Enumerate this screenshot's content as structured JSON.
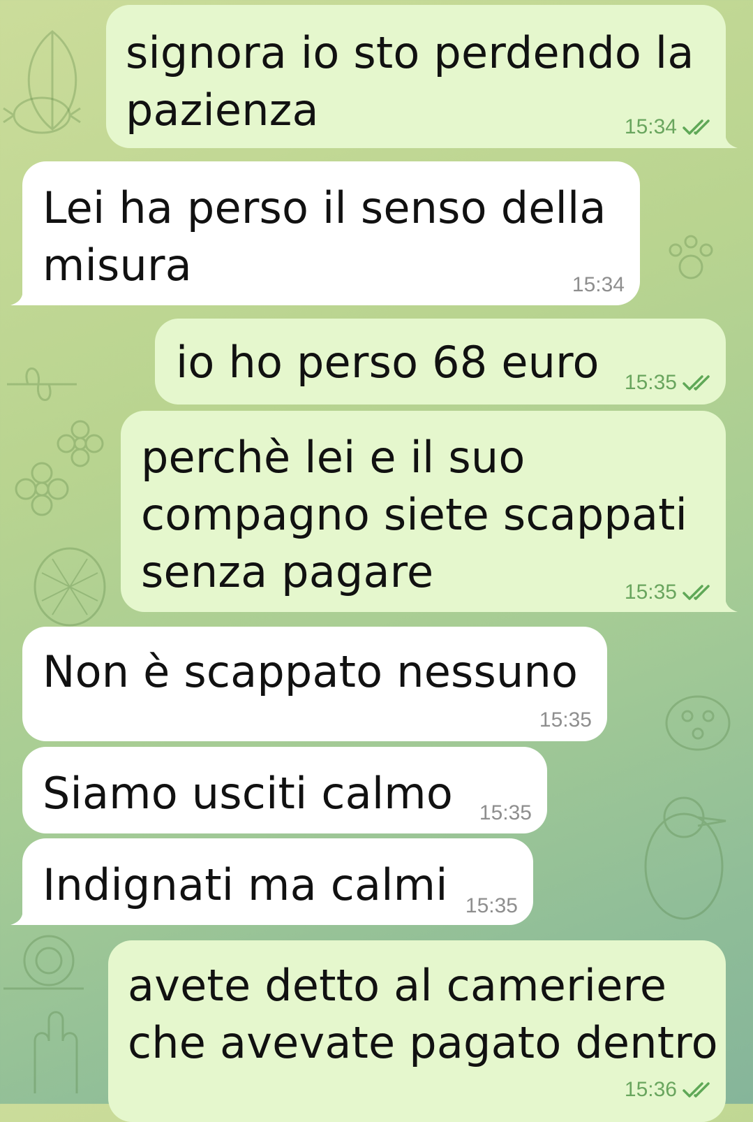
{
  "messages": [
    {
      "text": "signora io sto perdendo la\npazienza",
      "time": "15:34",
      "direction": "out",
      "status": "read"
    },
    {
      "text": "Lei ha perso il senso della\nmisura",
      "time": "15:34",
      "direction": "in"
    },
    {
      "text": "io ho perso 68 euro",
      "time": "15:35",
      "direction": "out",
      "status": "read"
    },
    {
      "text": "perchè lei e il suo\ncompagno siete scappati\nsenza pagare",
      "time": "15:35",
      "direction": "out",
      "status": "read"
    },
    {
      "text": "Non è scappato nessuno",
      "time": "15:35",
      "direction": "in"
    },
    {
      "text": "Siamo usciti calmo",
      "time": "15:35",
      "direction": "in"
    },
    {
      "text": "Indignati ma calmi",
      "time": "15:35",
      "direction": "in"
    },
    {
      "text": "avete detto al cameriere\nche avevate pagato dentro",
      "time": "15:36",
      "direction": "out",
      "status": "read"
    }
  ],
  "colors": {
    "outgoing_bubble": "#e5f7cd",
    "incoming_bubble": "#ffffff",
    "read_check": "#5fa857",
    "background": "#b9d490"
  },
  "icons": {
    "read_receipt": "double-check-icon",
    "wallpaper": "doodle-pattern"
  }
}
